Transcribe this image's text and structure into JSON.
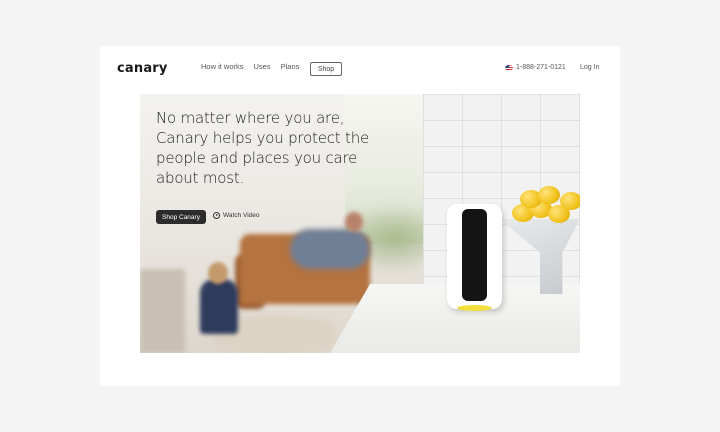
{
  "header": {
    "logo_text": "canary",
    "nav": [
      "How it works",
      "Uses",
      "Plans"
    ],
    "shop_label": "Shop",
    "phone": "1-888-271-0121",
    "phone_flag_icon": "us-flag-icon",
    "login_label": "Log In"
  },
  "hero": {
    "headline": "No matter where you are, Canary helps you protect the people and places you care about most.",
    "primary_cta": "Shop Canary",
    "secondary_cta": "Watch Video",
    "secondary_cta_icon": "play-circle-icon"
  },
  "colors": {
    "background": "#f4f4f4",
    "card": "#ffffff",
    "button_dark": "#2c2c2c",
    "device_glow": "#f3df3c"
  }
}
